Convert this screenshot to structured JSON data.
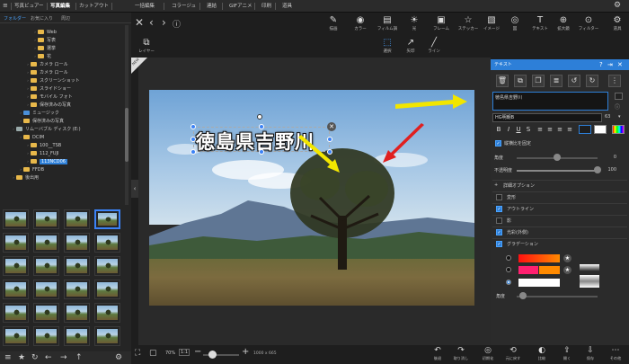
{
  "top_tabs": [
    {
      "label": "写真ビュアー",
      "active": false
    },
    {
      "label": "写真編集",
      "active": true
    },
    {
      "label": "カットアウト",
      "active": false
    },
    {
      "label": "一括編集",
      "active": false
    },
    {
      "label": "コラージュ",
      "active": false
    },
    {
      "label": "連結",
      "active": false
    },
    {
      "label": "GIFアニメ",
      "active": false
    },
    {
      "label": "印刷",
      "active": false
    },
    {
      "label": "道具",
      "active": false
    }
  ],
  "left_panel": {
    "tabs": [
      "フォルダー",
      "お気に入り",
      "周辺"
    ],
    "tree": [
      {
        "label": "Web",
        "indent": 4,
        "type": "folder"
      },
      {
        "label": "写表",
        "indent": 4,
        "type": "folder"
      },
      {
        "label": "選挙",
        "indent": 4,
        "type": "folder"
      },
      {
        "label": "花",
        "indent": 4,
        "type": "folder"
      },
      {
        "label": "カメラ ロール",
        "indent": 3,
        "type": "folder"
      },
      {
        "label": "カメラ ロール",
        "indent": 3,
        "type": "folder"
      },
      {
        "label": "スクリーンショット",
        "indent": 3,
        "type": "folder"
      },
      {
        "label": "スライドショー",
        "indent": 3,
        "type": "folder"
      },
      {
        "label": "モバイル フォト",
        "indent": 3,
        "type": "folder"
      },
      {
        "label": "保存済みの写真",
        "indent": 3,
        "type": "folder"
      },
      {
        "label": "ミュージック",
        "indent": 2,
        "type": "blue"
      },
      {
        "label": "保存済みの写真",
        "indent": 2,
        "type": "folder"
      },
      {
        "label": "リムーバブル ディスク (E:)",
        "indent": 1,
        "type": "gray"
      },
      {
        "label": "DCIM",
        "indent": 2,
        "type": "folder"
      },
      {
        "label": "100__TSB",
        "indent": 3,
        "type": "folder"
      },
      {
        "label": "112_FUJI",
        "indent": 3,
        "type": "folder"
      },
      {
        "label": "113NCD06",
        "indent": 3,
        "type": "folder",
        "selected": true
      },
      {
        "label": "FFDB",
        "indent": 2,
        "type": "folder"
      },
      {
        "label": "後出用",
        "indent": 1,
        "type": "folder"
      }
    ]
  },
  "toolbar": {
    "buttons": [
      {
        "label": "描画",
        "icon": "edit-icon"
      },
      {
        "label": "カラー",
        "icon": "color-icon"
      },
      {
        "label": "フィルム調",
        "icon": "film-icon"
      },
      {
        "label": "光",
        "icon": "light-icon"
      },
      {
        "label": "フレーム",
        "icon": "frame-icon"
      },
      {
        "label": "ステッカー",
        "icon": "sticker-icon"
      },
      {
        "label": "イメージ",
        "icon": "image-icon"
      },
      {
        "label": "図",
        "icon": "shape-icon"
      },
      {
        "label": "テキスト",
        "icon": "text-icon"
      },
      {
        "label": "拡大鏡",
        "icon": "magnifier-icon"
      },
      {
        "label": "フィルター",
        "icon": "filter-icon"
      },
      {
        "label": "道具",
        "icon": "tools-icon"
      }
    ],
    "sub_buttons": [
      {
        "label": "レイヤー",
        "icon": "layer-icon"
      },
      {
        "label": "選択",
        "icon": "select-icon"
      },
      {
        "label": "矢印",
        "icon": "arrow-icon"
      },
      {
        "label": "ライン",
        "icon": "line-icon"
      }
    ]
  },
  "canvas": {
    "overlay_text": "徳島県吉野川",
    "corner_badge": "NEW"
  },
  "bottom_bar": {
    "zoom_value": "70%",
    "ratio": "1:1",
    "dimensions": "1000 x 665",
    "buttons": [
      {
        "label": "後退",
        "icon": "undo-icon"
      },
      {
        "label": "取り消し",
        "icon": "redo-icon"
      },
      {
        "label": "初期化",
        "icon": "reset-icon"
      },
      {
        "label": "元に戻す",
        "icon": "revert-icon"
      },
      {
        "label": "比較",
        "icon": "compare-icon"
      },
      {
        "label": "開く",
        "icon": "open-icon"
      },
      {
        "label": "保存",
        "icon": "save-icon"
      },
      {
        "label": "その他",
        "icon": "more-icon"
      }
    ]
  },
  "text_panel": {
    "title": "テキスト",
    "input_value": "徳島県吉野川",
    "font": "HG明朝B",
    "font_size": "63",
    "vertical_checkbox_label": "縦横比を固定",
    "angle_label": "角度",
    "angle_value": "0",
    "opacity_label": "不透明度",
    "opacity_value": "100",
    "detail_options_label": "詳細オプション",
    "options": [
      {
        "label": "変形",
        "checked": false
      },
      {
        "label": "アウトライン",
        "checked": true
      },
      {
        "label": "影",
        "checked": false
      },
      {
        "label": "光彩(外側)",
        "checked": true
      },
      {
        "label": "グラデーション",
        "checked": true
      }
    ],
    "gradient_angle_label": "角度"
  },
  "colors": {
    "accent": "#2d7fd8",
    "annotation_yellow": "#f2e600",
    "annotation_red": "#e02020"
  }
}
